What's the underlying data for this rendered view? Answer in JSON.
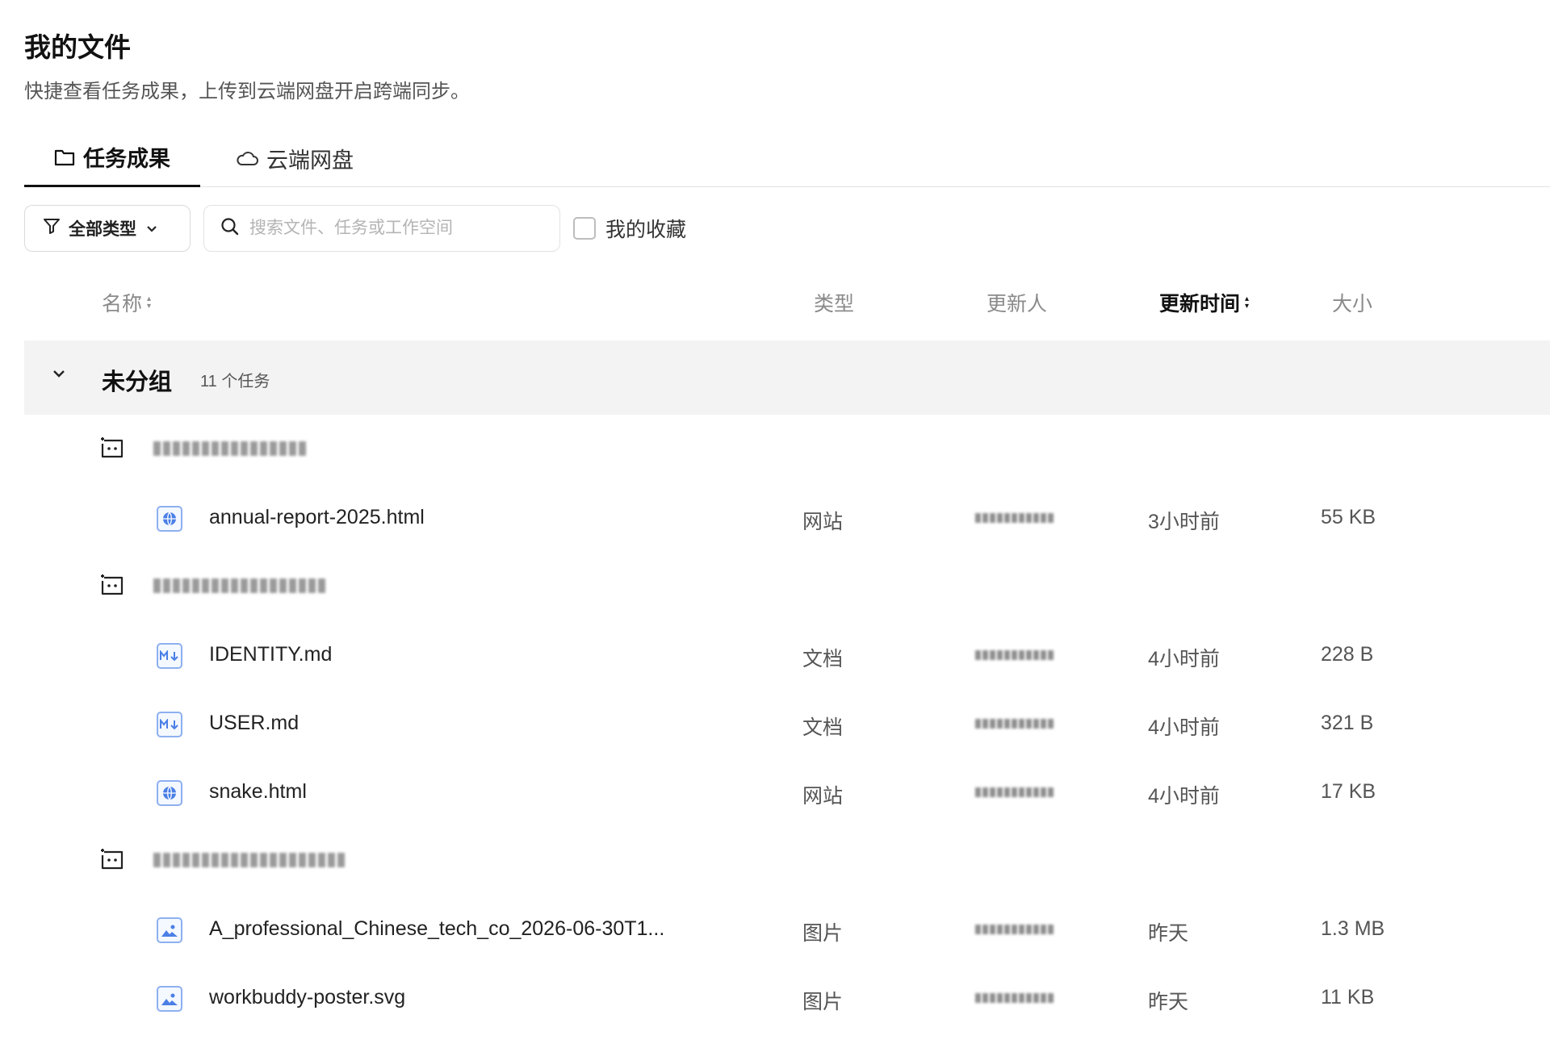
{
  "page": {
    "title": "我的文件",
    "subtitle": "快捷查看任务成果，上传到云端网盘开启跨端同步。"
  },
  "tabs": [
    {
      "label": "任务成果",
      "icon": "folder-icon",
      "active": true
    },
    {
      "label": "云端网盘",
      "icon": "cloud-icon",
      "active": false
    }
  ],
  "toolbar": {
    "filter_label": "全部类型",
    "search_placeholder": "搜索文件、任务或工作空间",
    "favorites_label": "我的收藏"
  },
  "table": {
    "columns": {
      "name": "名称",
      "type": "类型",
      "updater": "更新人",
      "updated": "更新时间",
      "size": "大小"
    }
  },
  "group": {
    "title": "未分组",
    "count": "11 个任务"
  },
  "files": [
    {
      "name": "annual-report-2025.html",
      "type": "网站",
      "time": "3小时前",
      "size": "55 KB",
      "icon": "globe-icon"
    },
    {
      "name": "IDENTITY.md",
      "type": "文档",
      "time": "4小时前",
      "size": "228 B",
      "icon": "markdown-icon"
    },
    {
      "name": "USER.md",
      "type": "文档",
      "time": "4小时前",
      "size": "321 B",
      "icon": "markdown-icon"
    },
    {
      "name": "snake.html",
      "type": "网站",
      "time": "4小时前",
      "size": "17 KB",
      "icon": "globe-icon"
    },
    {
      "name": "A_professional_Chinese_tech_co_2026-06-30T1...",
      "type": "图片",
      "time": "昨天",
      "size": "1.3 MB",
      "icon": "image-icon"
    },
    {
      "name": "workbuddy-poster.svg",
      "type": "图片",
      "time": "昨天",
      "size": "11 KB",
      "icon": "image-icon"
    }
  ],
  "colors": {
    "accent": "#111111",
    "group_bg": "#f3f3f3",
    "file_icon": "#4a7fe6",
    "muted": "#8a8a8a"
  }
}
